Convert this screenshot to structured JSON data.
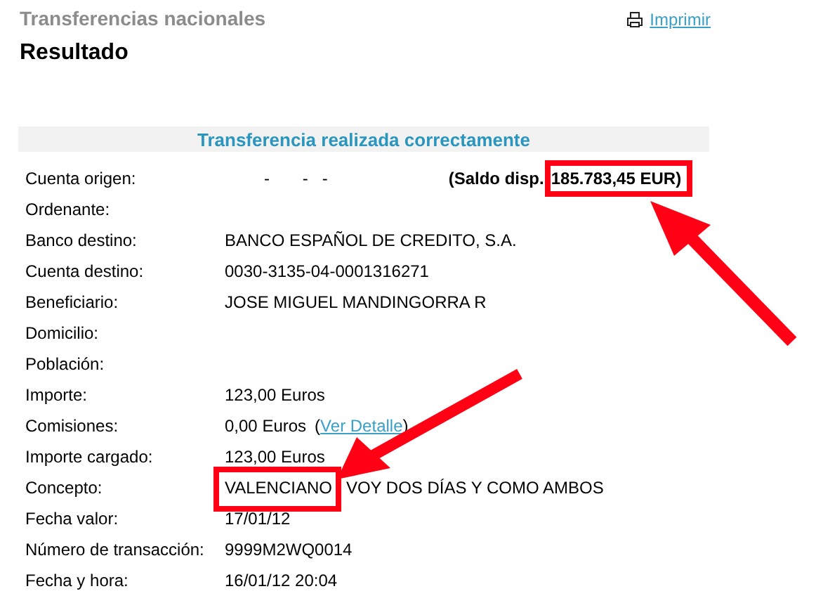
{
  "header": {
    "section": "Transferencias nacionales",
    "title": "Resultado",
    "print_link": "Imprimir"
  },
  "banner": "Transferencia realizada correctamente",
  "rows": [
    {
      "kind": "balance",
      "label": "Cuenta origen:",
      "value": "-       -   -",
      "balance_label": "(Saldo disp.",
      "balance": "185.783,45 EUR)"
    },
    {
      "kind": "text",
      "label": "Ordenante:"
    },
    {
      "kind": "text",
      "label": "Banco destino:",
      "value": "BANCO ESPAÑOL DE CREDITO, S.A."
    },
    {
      "kind": "text",
      "label": "Cuenta destino:",
      "value": "0030-3135-04-0001316271"
    },
    {
      "kind": "text",
      "label": "Beneficiario:",
      "value": "JOSE MIGUEL MANDINGORRA R"
    },
    {
      "kind": "text",
      "label": "Domicilio:"
    },
    {
      "kind": "text",
      "label": "Población:"
    },
    {
      "kind": "text",
      "label": "Importe:",
      "value": "123,00 Euros"
    },
    {
      "kind": "link",
      "label": "Comisiones:",
      "value": "0,00 Euros",
      "paren_open": "(",
      "link": "Ver Detalle",
      "paren_close": ")"
    },
    {
      "kind": "text",
      "label": "Importe cargado:",
      "value": "123,00 Euros"
    },
    {
      "kind": "text",
      "label": "Concepto:",
      "value": "VALENCIANO   VOY DOS DÍAS Y COMO AMBOS"
    },
    {
      "kind": "text",
      "label": "Fecha valor:",
      "value": "17/01/12"
    },
    {
      "kind": "text",
      "label": "Número de transacción:",
      "value": "9999M2WQ0014"
    },
    {
      "kind": "text",
      "label": "Fecha y hora:",
      "value": "16/01/12 20:04"
    }
  ]
}
